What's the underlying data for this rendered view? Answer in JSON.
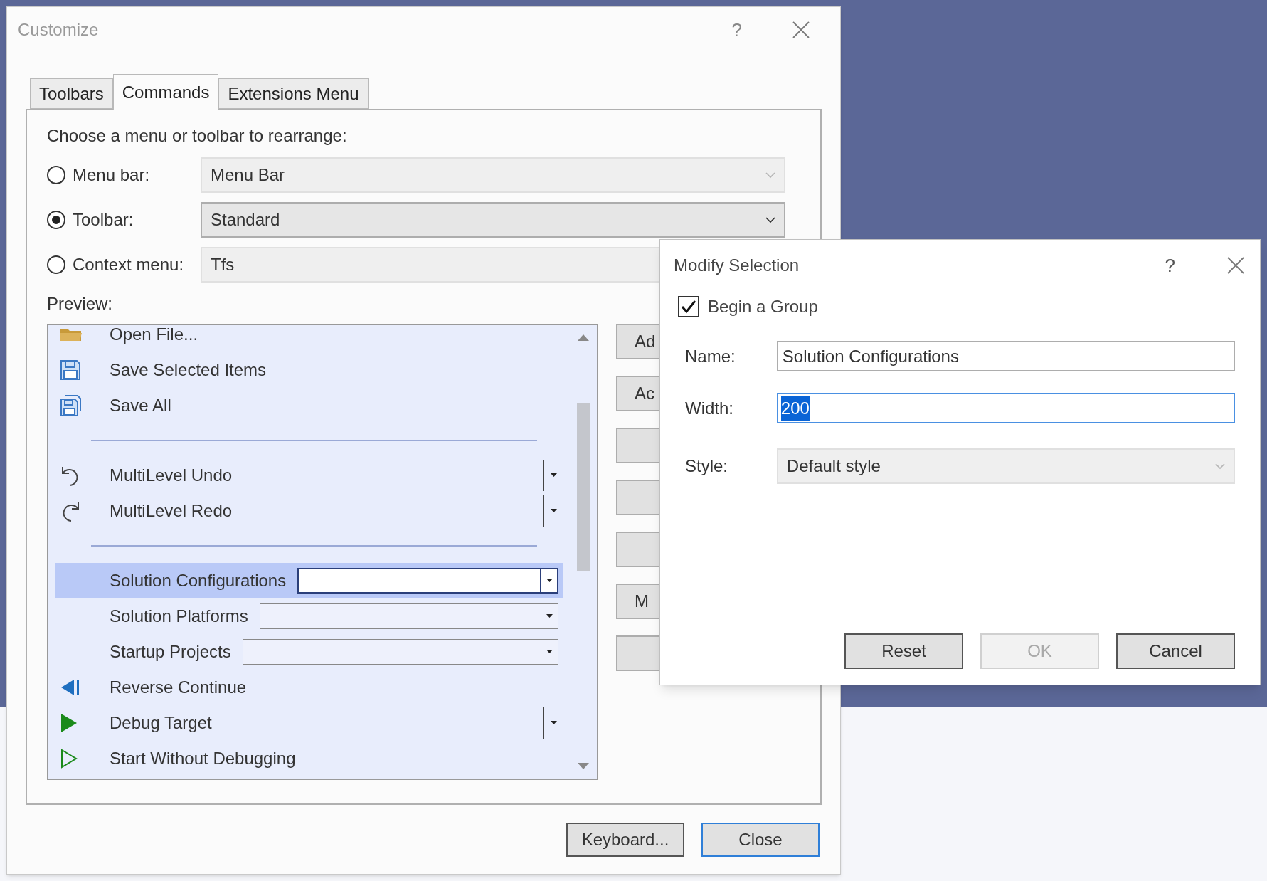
{
  "customize_dialog": {
    "title": "Customize",
    "help": "?",
    "tabs": [
      {
        "label": "Toolbars",
        "selected": false
      },
      {
        "label": "Commands",
        "selected": true
      },
      {
        "label": "Extensions Menu",
        "selected": false
      }
    ],
    "instruction": "Choose a menu or toolbar to rearrange:",
    "options": [
      {
        "label": "Menu bar:",
        "selected": false,
        "value": "Menu Bar",
        "disabled": true
      },
      {
        "label": "Toolbar:",
        "selected": true,
        "value": "Standard",
        "disabled": false
      },
      {
        "label": "Context menu:",
        "selected": false,
        "value": "Tfs",
        "disabled": true
      }
    ],
    "preview_label": "Preview:",
    "preview_items": [
      {
        "kind": "command",
        "label": "Open File...",
        "selected": false,
        "split": false
      },
      {
        "kind": "command",
        "label": "Save Selected Items",
        "selected": false,
        "split": false
      },
      {
        "kind": "command",
        "label": "Save All",
        "selected": false,
        "split": false
      },
      {
        "kind": "separator"
      },
      {
        "kind": "command",
        "label": "MultiLevel Undo",
        "selected": false,
        "split": true
      },
      {
        "kind": "command",
        "label": "MultiLevel Redo",
        "selected": false,
        "split": true
      },
      {
        "kind": "separator"
      },
      {
        "kind": "combo",
        "label": "Solution Configurations",
        "selected": true
      },
      {
        "kind": "combo",
        "label": "Solution Platforms",
        "selected": false
      },
      {
        "kind": "combo",
        "label": "Startup Projects",
        "selected": false
      },
      {
        "kind": "command",
        "label": "Reverse Continue",
        "selected": false,
        "split": false
      },
      {
        "kind": "command",
        "label": "Debug Target",
        "selected": false,
        "split": true
      },
      {
        "kind": "command",
        "label": "Start Without Debugging",
        "selected": false,
        "split": false
      }
    ],
    "side_buttons": [
      {
        "kind": "labeled",
        "label": "Ad"
      },
      {
        "kind": "labeled",
        "label": "Ac"
      },
      {
        "kind": "blank"
      },
      {
        "kind": "blank"
      },
      {
        "kind": "blank"
      },
      {
        "kind": "labeled",
        "label": "M"
      },
      {
        "kind": "blank"
      }
    ],
    "buttons": [
      {
        "label": "Keyboard...",
        "default": false
      },
      {
        "label": "Close",
        "default": true
      }
    ]
  },
  "modify_dialog": {
    "title": "Modify Selection",
    "help": "?",
    "begin_group": {
      "label": "Begin a Group",
      "checked": true
    },
    "name": {
      "label": "Name:",
      "value": "Solution Configurations"
    },
    "width": {
      "label": "Width:",
      "value": "200",
      "text_selected": true
    },
    "style": {
      "label": "Style:",
      "value": "Default style",
      "disabled": true
    },
    "buttons": [
      {
        "label": "Reset",
        "disabled": false
      },
      {
        "label": "OK",
        "disabled": true
      },
      {
        "label": "Cancel",
        "disabled": false
      }
    ]
  }
}
